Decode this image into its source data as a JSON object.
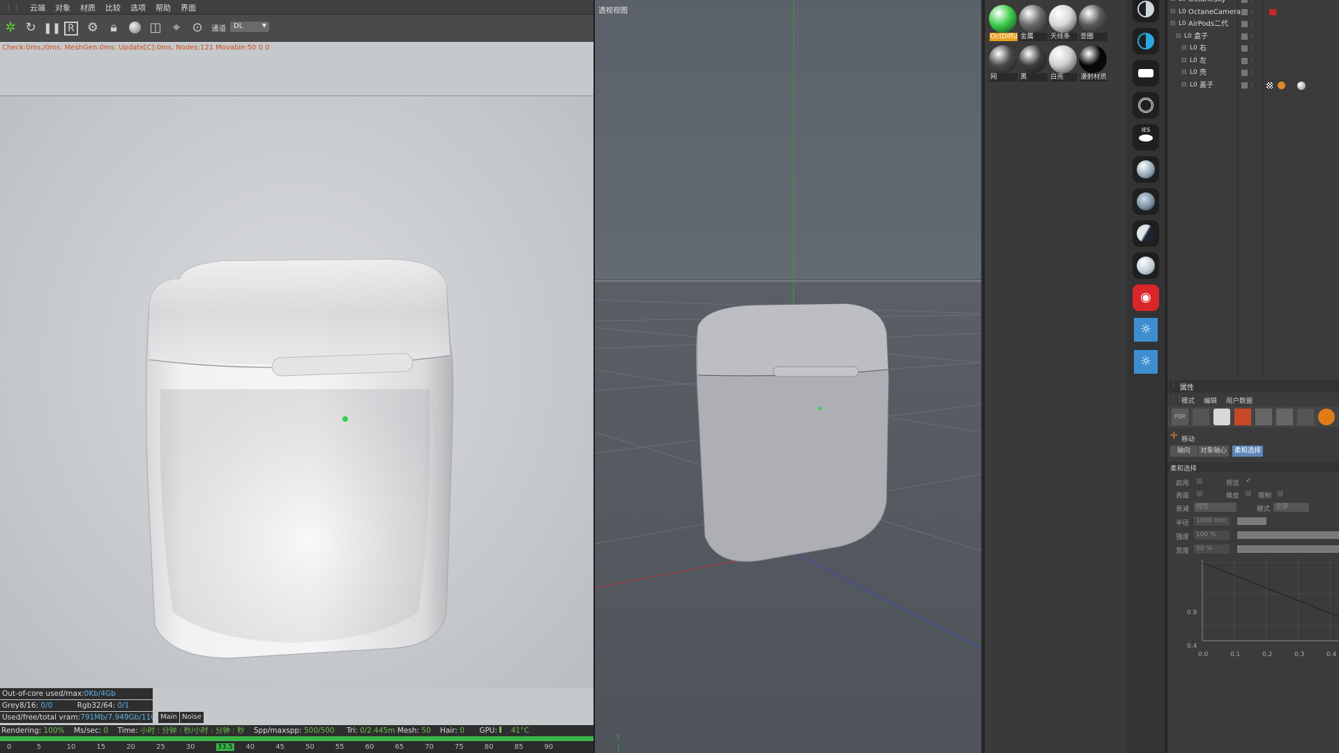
{
  "render_window": {
    "menu": [
      "云端",
      "对象",
      "材质",
      "比较",
      "选项",
      "帮助",
      "界面"
    ],
    "channel_label": "通道",
    "channel_value": "DL",
    "status_message": "Check:0ms./0ms. MeshGen:0ms. Update[C]:0ms. Nodes:121 Movable:50  0 0",
    "info": {
      "out_of_core_label": "Out-of-core used/max:",
      "out_of_core_value": "0Kb/4Gb",
      "grey_label": "Grey8/16:",
      "grey_value": "0/0",
      "rgb_label": "Rgb32/64:",
      "rgb_value": "0/1",
      "vram_label": "Used/free/total vram:",
      "vram_value": "791Mb/7.949Gb/11G",
      "tab_main": "Main",
      "tab_noise": "Noise"
    },
    "stats": {
      "rendering_label": "Rendering:",
      "rendering_value": "100%",
      "ms_label": "Ms/sec:",
      "ms_value": "0",
      "time_label": "Time:",
      "time_value": "小时 : 分钟 : 秒/小时 : 分钟 : 秒",
      "spp_label": "Spp/maxspp:",
      "spp_value": "500/500",
      "tri_label": "Tri:",
      "tri_value": "0/2.445m",
      "mesh_label": "Mesh:",
      "mesh_value": "50",
      "hair_label": "Hair:",
      "hair_value": "0",
      "gpu_label": "GPU:",
      "gpu_value": "41°C"
    },
    "progress": 1.0,
    "timeline": {
      "ticks": [
        "0",
        "5",
        "10",
        "15",
        "20",
        "25",
        "30",
        "33.5",
        "40",
        "45",
        "50",
        "55",
        "60",
        "65",
        "70",
        "75",
        "80",
        "85",
        "90"
      ],
      "current": "33.5"
    }
  },
  "viewport": {
    "title": "透视视图",
    "axis_label": "Y"
  },
  "materials": [
    {
      "label": "OctDiffu",
      "color": "#3bd04a",
      "highlight": true
    },
    {
      "label": "金属",
      "color": "#6a6a6a"
    },
    {
      "label": "天线条",
      "color": "#d8d8d8"
    },
    {
      "label": "壶圈",
      "color": "#5a5a5a"
    },
    {
      "label": "网",
      "color": "#4a4a4a"
    },
    {
      "label": "黑",
      "color": "#3c3c3c"
    },
    {
      "label": "白亮",
      "color": "#cfcfcf"
    },
    {
      "label": "漫射材质",
      "color": "#050505"
    }
  ],
  "octane_toolbar": [
    {
      "icon": "half-moon-icon"
    },
    {
      "icon": "blue-half-moon-icon"
    },
    {
      "icon": "area-light-icon"
    },
    {
      "icon": "target-light-icon"
    },
    {
      "icon": "ies-light-icon",
      "text": "IES"
    },
    {
      "icon": "sphere-icon"
    },
    {
      "icon": "glossy-sphere-icon"
    },
    {
      "icon": "dark-sphere-icon"
    },
    {
      "icon": "light-sphere-icon"
    },
    {
      "icon": "camera-icon"
    },
    {
      "icon": "daylight-icon"
    },
    {
      "icon": "daylight-2-icon"
    }
  ],
  "objects": [
    {
      "name": "OctaneSky",
      "indent": 0
    },
    {
      "name": "OctaneCamera",
      "indent": 0
    },
    {
      "name": "AirPods二代",
      "indent": 0
    },
    {
      "name": "盒子",
      "indent": 1
    },
    {
      "name": "右",
      "indent": 2
    },
    {
      "name": "左",
      "indent": 2
    },
    {
      "name": "壳",
      "indent": 2
    },
    {
      "name": "盖子",
      "indent": 2
    }
  ],
  "attributes": {
    "title": "属性",
    "menu": [
      "模式",
      "编辑",
      "用户数据"
    ],
    "tool_name": "移动",
    "tabs": [
      "轴向",
      "对象轴心",
      "柔和选择"
    ],
    "active_tab": "柔和选择",
    "section": "柔和选择",
    "enable_label": "启用",
    "preview_label": "预览",
    "surface_label": "表面",
    "rubber_label": "橡皮",
    "limit_label": "限制",
    "falloff_label": "衰减",
    "falloff_value": "线性",
    "mode_label": "模式",
    "mode_value": "全部",
    "radius_label": "半径",
    "radius_value": "1000 mm",
    "strength_label": "强度",
    "strength_value": "100 %",
    "width_label": "宽度",
    "width_value": "50 %",
    "graph": {
      "y_ticks": [
        "0.8",
        "0.4"
      ],
      "x_ticks": [
        "0.0",
        "0.1",
        "0.2",
        "0.3",
        "0.4"
      ]
    }
  }
}
